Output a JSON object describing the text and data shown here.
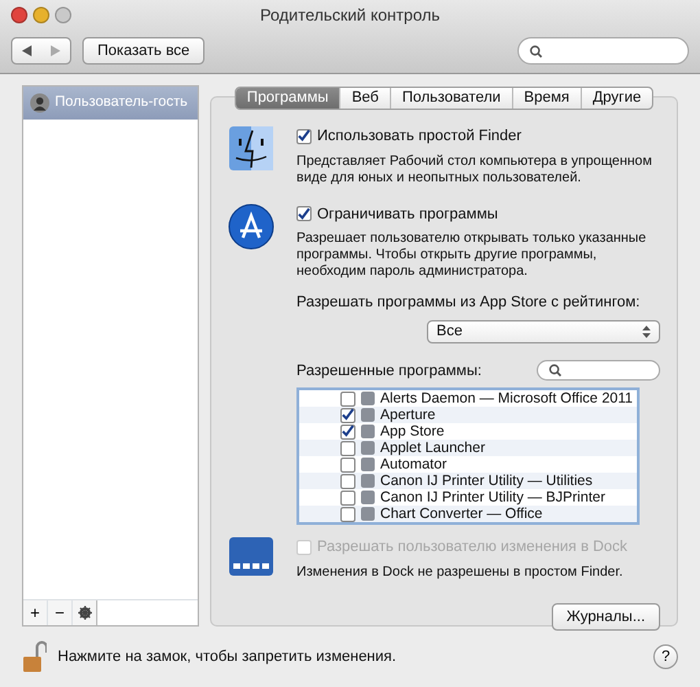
{
  "window": {
    "title": "Родительский контроль"
  },
  "toolbar": {
    "show_all_button": "Показать все"
  },
  "sidebar": {
    "users": [
      {
        "name": "Пользователь-гость",
        "selected": true
      }
    ],
    "buttons": [
      "+",
      "−"
    ]
  },
  "tabs": [
    {
      "label": "Программы",
      "selected": true
    },
    {
      "label": "Веб",
      "selected": false
    },
    {
      "label": "Пользователи",
      "selected": false
    },
    {
      "label": "Время",
      "selected": false
    },
    {
      "label": "Другие",
      "selected": false
    }
  ],
  "finder": {
    "label": "Использовать простой Finder",
    "checked": true,
    "description": "Представляет Рабочий стол компьютера в упрощенном виде для юных и неопытных пользователей."
  },
  "limit_apps": {
    "label": "Ограничивать программы",
    "checked": true,
    "description": "Разрешает пользователю открывать только указанные программы. Чтобы открыть другие программы, необходим пароль администратора."
  },
  "rating": {
    "label": "Разрешать программы из App Store с рейтингом:",
    "value": "Все"
  },
  "allowed": {
    "label": "Разрешенные программы:",
    "apps": [
      {
        "name": "Alerts Daemon — Microsoft Office 2011",
        "checked": false
      },
      {
        "name": "Aperture",
        "checked": true
      },
      {
        "name": "App Store",
        "checked": true
      },
      {
        "name": "Applet Launcher",
        "checked": false
      },
      {
        "name": "Automator",
        "checked": false
      },
      {
        "name": "Canon IJ Printer Utility — Utilities",
        "checked": false
      },
      {
        "name": "Canon IJ Printer Utility — BJPrinter",
        "checked": false
      },
      {
        "name": "Chart Converter — Office",
        "checked": false
      }
    ]
  },
  "dock": {
    "label": "Разрешать пользователю изменения в Dock",
    "checked": false,
    "disabled": true,
    "note": "Изменения в Dock не разрешены в простом Finder."
  },
  "logs_button": "Журналы...",
  "status_bar": {
    "locked": false,
    "text": "Нажмите на замок, чтобы запретить изменения.",
    "help_button": "?"
  }
}
